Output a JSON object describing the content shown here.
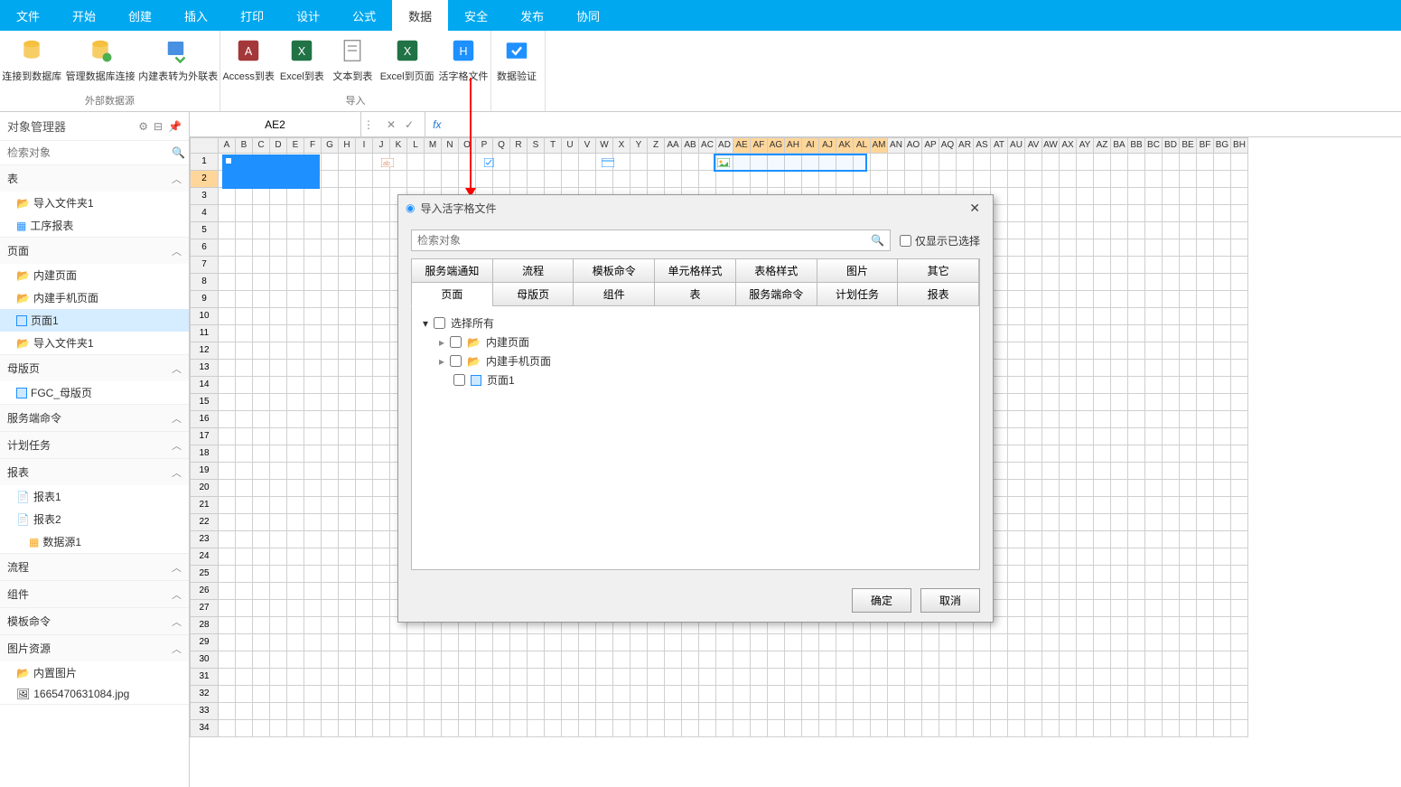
{
  "ribbon": {
    "tabs": [
      "文件",
      "开始",
      "创建",
      "插入",
      "打印",
      "设计",
      "公式",
      "数据",
      "安全",
      "发布",
      "协同"
    ],
    "active": "数据",
    "groups": {
      "external": {
        "label": "外部数据源",
        "buttons": [
          "连接到数据库",
          "管理数据库连接",
          "内建表转为外联表"
        ]
      },
      "import": {
        "label": "导入",
        "buttons": [
          "Access到表",
          "Excel到表",
          "文本到表",
          "Excel到页面",
          "活字格文件"
        ]
      },
      "validation": {
        "buttons": [
          "数据验证"
        ]
      }
    }
  },
  "sidebar": {
    "title": "对象管理器",
    "search_placeholder": "检索对象",
    "sections": {
      "table": {
        "label": "表",
        "items": [
          "导入文件夹1",
          "工序报表"
        ]
      },
      "page": {
        "label": "页面",
        "items": [
          "内建页面",
          "内建手机页面",
          "页面1",
          "导入文件夹1"
        ],
        "active": "页面1"
      },
      "master": {
        "label": "母版页",
        "items": [
          "FGC_母版页"
        ]
      },
      "servercmd": {
        "label": "服务端命令"
      },
      "schedule": {
        "label": "计划任务"
      },
      "report": {
        "label": "报表",
        "items": [
          "报表1",
          "报表2"
        ],
        "subitems": [
          "数据源1"
        ]
      },
      "flow": {
        "label": "流程"
      },
      "component": {
        "label": "组件"
      },
      "tplcmd": {
        "label": "模板命令"
      },
      "imgres": {
        "label": "图片资源",
        "items": [
          "内置图片",
          "1665470631084.jpg"
        ]
      }
    }
  },
  "formula_bar": {
    "namebox": "AE2",
    "fx": "fx"
  },
  "grid": {
    "columns": [
      "A",
      "B",
      "C",
      "D",
      "E",
      "F",
      "G",
      "H",
      "I",
      "J",
      "K",
      "L",
      "M",
      "N",
      "O",
      "P",
      "Q",
      "R",
      "S",
      "T",
      "U",
      "V",
      "W",
      "X",
      "Y",
      "Z",
      "AA",
      "AB",
      "AC",
      "AD",
      "AE",
      "AF",
      "AG",
      "AH",
      "AI",
      "AJ",
      "AK",
      "AL",
      "AM",
      "AN",
      "AO",
      "AP",
      "AQ",
      "AR",
      "AS",
      "AT",
      "AU",
      "AV",
      "AW",
      "AX",
      "AY",
      "AZ",
      "BA",
      "BB",
      "BC",
      "BD",
      "BE",
      "BF",
      "BG",
      "BH"
    ],
    "rows": 34,
    "selected_cols": [
      "AE",
      "AF",
      "AG",
      "AH",
      "AI",
      "AJ",
      "AK",
      "AL",
      "AM"
    ],
    "selected_row": 2
  },
  "dialog": {
    "title": "导入活字格文件",
    "search_placeholder": "检索对象",
    "only_selected": "仅显示已选择",
    "tabs_row1": [
      "服务端通知",
      "流程",
      "模板命令",
      "单元格样式",
      "表格样式",
      "图片",
      "其它"
    ],
    "tabs_row2": [
      "页面",
      "母版页",
      "组件",
      "表",
      "服务端命令",
      "计划任务",
      "报表"
    ],
    "active_tab": "页面",
    "tree": {
      "root": "选择所有",
      "items": [
        "内建页面",
        "内建手机页面",
        "页面1"
      ]
    },
    "buttons": {
      "ok": "确定",
      "cancel": "取消"
    }
  }
}
